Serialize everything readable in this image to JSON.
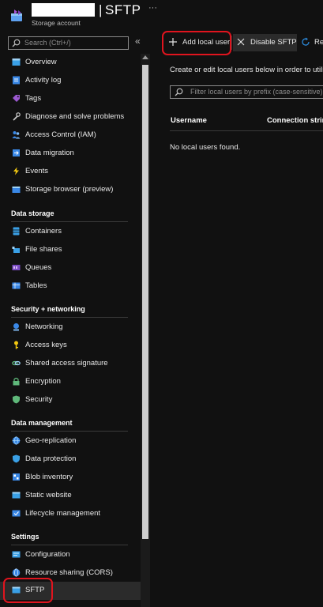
{
  "header": {
    "title": "SFTP",
    "separator": "|",
    "subtitle": "Storage account",
    "more": "···"
  },
  "sidebar": {
    "search_placeholder": "Search (Ctrl+/)",
    "collapse": "«",
    "top_items": [
      {
        "label": "Overview"
      },
      {
        "label": "Activity log"
      },
      {
        "label": "Tags"
      },
      {
        "label": "Diagnose and solve problems"
      },
      {
        "label": "Access Control (IAM)"
      },
      {
        "label": "Data migration"
      },
      {
        "label": "Events"
      },
      {
        "label": "Storage browser (preview)"
      }
    ],
    "sections": [
      {
        "title": "Data storage",
        "items": [
          {
            "label": "Containers"
          },
          {
            "label": "File shares"
          },
          {
            "label": "Queues"
          },
          {
            "label": "Tables"
          }
        ]
      },
      {
        "title": "Security + networking",
        "items": [
          {
            "label": "Networking"
          },
          {
            "label": "Access keys"
          },
          {
            "label": "Shared access signature"
          },
          {
            "label": "Encryption"
          },
          {
            "label": "Security"
          }
        ]
      },
      {
        "title": "Data management",
        "items": [
          {
            "label": "Geo-replication"
          },
          {
            "label": "Data protection"
          },
          {
            "label": "Blob inventory"
          },
          {
            "label": "Static website"
          },
          {
            "label": "Lifecycle management"
          }
        ]
      },
      {
        "title": "Settings",
        "items": [
          {
            "label": "Configuration"
          },
          {
            "label": "Resource sharing (CORS)"
          },
          {
            "label": "SFTP",
            "selected": true
          }
        ]
      }
    ]
  },
  "toolbar": {
    "add_local_user": "Add local user",
    "disable_sftp": "Disable SFTP",
    "refresh": "Re"
  },
  "main": {
    "description": "Create or edit local users below in order to utiliz",
    "filter_placeholder": "Filter local users by prefix (case-sensitive)",
    "columns": [
      "Username",
      "Connection string"
    ],
    "empty_message": "No local users found."
  },
  "colors": {
    "background": "#111111",
    "accent_blue": "#2b88d8",
    "selected_bg": "#2b2b2b",
    "highlight_red": "#e0141e"
  }
}
